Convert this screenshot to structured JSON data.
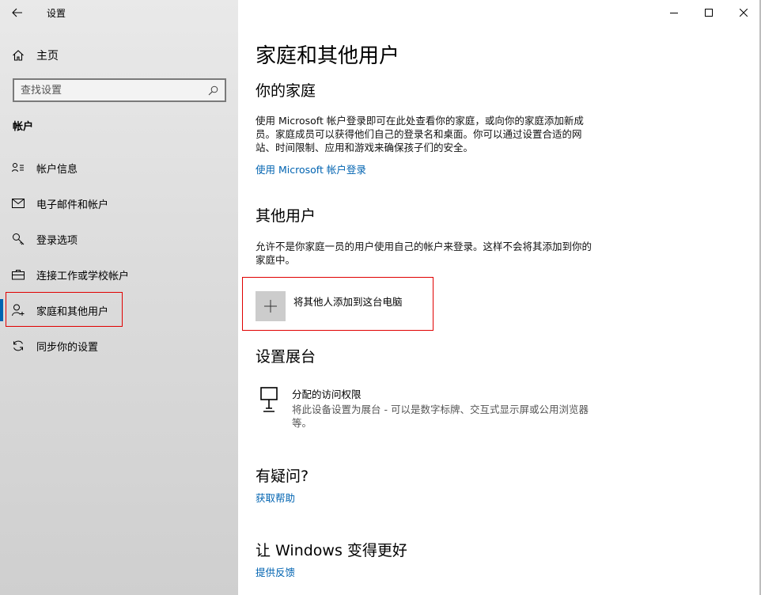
{
  "window": {
    "title": "设置",
    "controls": {
      "minimize": "minimize-icon",
      "maximize": "maximize-icon",
      "close": "close-icon"
    }
  },
  "sidebar": {
    "home_label": "主页",
    "search": {
      "placeholder": "查找设置"
    },
    "section": "帐户",
    "items": [
      {
        "label": "帐户信息",
        "icon": "person-card-icon"
      },
      {
        "label": "电子邮件和帐户",
        "icon": "mail-icon"
      },
      {
        "label": "登录选项",
        "icon": "key-icon"
      },
      {
        "label": "连接工作或学校帐户",
        "icon": "briefcase-icon"
      },
      {
        "label": "家庭和其他用户",
        "icon": "person-add-icon",
        "selected": true
      },
      {
        "label": "同步你的设置",
        "icon": "sync-icon"
      }
    ]
  },
  "main": {
    "title": "家庭和其他用户",
    "family": {
      "heading": "你的家庭",
      "description": "使用 Microsoft 帐户登录即可在此处查看你的家庭，或向你的家庭添加新成员。家庭成员可以获得他们自己的登录名和桌面。你可以通过设置合适的网站、时间限制、应用和游戏来确保孩子们的安全。",
      "link": "使用 Microsoft 帐户登录"
    },
    "others": {
      "heading": "其他用户",
      "description": "允许不是你家庭一员的用户使用自己的帐户来登录。这样不会将其添加到你的家庭中。",
      "add_label": "将其他人添加到这台电脑"
    },
    "kiosk": {
      "heading": "设置展台",
      "title": "分配的访问权限",
      "description": "将此设备设置为展台 - 可以是数字标牌、交互式显示屏或公用浏览器等。"
    },
    "help": {
      "heading": "有疑问?",
      "link": "获取帮助"
    },
    "feedback": {
      "heading": "让 Windows 变得更好",
      "link": "提供反馈"
    }
  },
  "colors": {
    "accent": "#0063b1",
    "highlight": "#e00000",
    "sidebar_bg": "#e6e6e6"
  }
}
